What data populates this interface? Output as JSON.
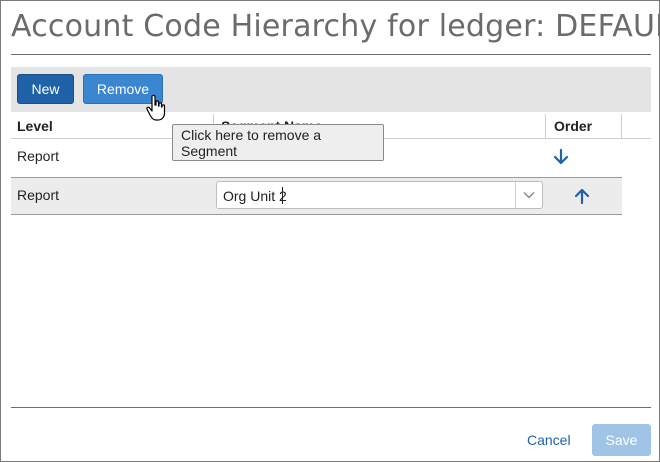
{
  "title": "Account Code Hierarchy for ledger: DEFAULT",
  "toolbar": {
    "new_label": "New",
    "remove_label": "Remove"
  },
  "tooltip": {
    "text": "Click here to remove a Segment"
  },
  "columns": {
    "level": "Level",
    "segment_name": "Segment Name",
    "order": "Order"
  },
  "rows": [
    {
      "level": "Report",
      "segment_name": "",
      "order_icon": "arrow-down-icon"
    },
    {
      "level": "Report",
      "segment_name": "Org Unit 2",
      "order_icon": "arrow-up-icon"
    }
  ],
  "footer": {
    "cancel_label": "Cancel",
    "save_label": "Save"
  },
  "colors": {
    "primary": "#1f62a7",
    "primary_light": "#3a86d1",
    "disabled": "#9fc4e6",
    "toolbar_bg": "#e4e4e4"
  }
}
